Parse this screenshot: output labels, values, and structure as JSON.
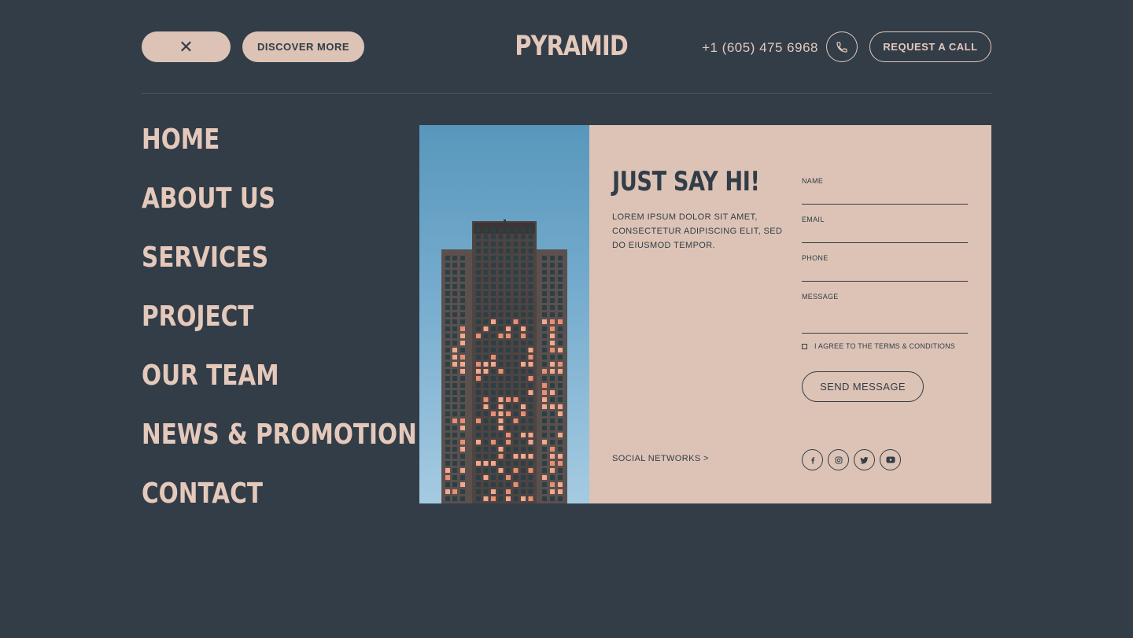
{
  "header": {
    "close_symbol": "✕",
    "discover_label": "DISCOVER MORE",
    "logo": "PYRAMID",
    "phone": "+1 (605) 475 6968",
    "request_label": "REQUEST A CALL"
  },
  "nav": {
    "items": [
      "HOME",
      "ABOUT US",
      "SERVICES",
      "PROJECT",
      "OUR TEAM",
      "NEWS & PROMOTION",
      "CONTACT"
    ]
  },
  "contact": {
    "title": "JUST SAY HI!",
    "text": "LOREM IPSUM DOLOR SIT AMET, CONSECTETUR ADIPISCING ELIT, SED DO EIUSMOD TEMPOR.",
    "fields": {
      "name": "NAME",
      "email": "EMAIL",
      "phone": "PHONE",
      "message": "MESSAGE"
    },
    "terms": "I AGREE TO THE TERMS & CONDITIONS",
    "send_label": "SEND MESSAGE",
    "social_label": "SOCIAL NETWORKS >",
    "social_icons": [
      "facebook-icon",
      "instagram-icon",
      "twitter-icon",
      "youtube-icon"
    ]
  },
  "colors": {
    "background": "#323d48",
    "accent": "#dcc3b5",
    "text_light": "#e4c9bb"
  }
}
